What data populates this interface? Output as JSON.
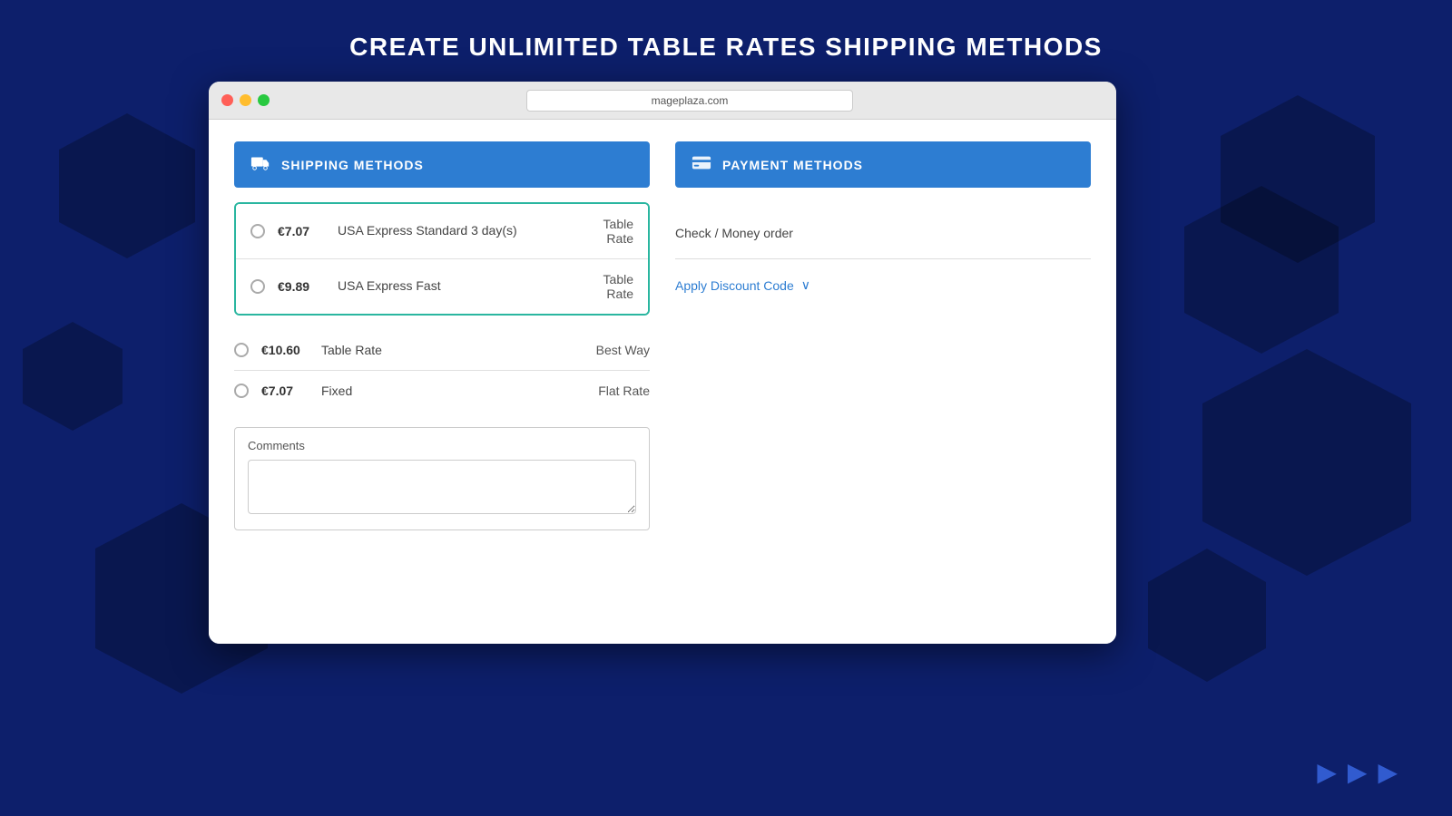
{
  "page": {
    "title": "CREATE UNLIMITED TABLE RATES SHIPPING METHODS",
    "address_bar": "mageplaza.com"
  },
  "shipping_section": {
    "header_label": "SHIPPING METHODS",
    "header_icon": "🚚",
    "highlighted_rows": [
      {
        "price": "€7.07",
        "name": "USA Express Standard 3 day(s)",
        "method_line1": "Table",
        "method_line2": "Rate"
      },
      {
        "price": "€9.89",
        "name": "USA Express Fast",
        "method_line1": "Table",
        "method_line2": "Rate"
      }
    ],
    "plain_rows": [
      {
        "price": "€10.60",
        "name": "Table Rate",
        "method": "Best Way"
      },
      {
        "price": "€7.07",
        "name": "Fixed",
        "method": "Flat Rate"
      }
    ],
    "comments_label": "Comments",
    "comments_placeholder": ""
  },
  "payment_section": {
    "header_label": "PAYMENT METHODS",
    "header_icon": "💳",
    "payment_option": "Check / Money order",
    "discount_label": "Apply Discount Code",
    "chevron": "∨"
  },
  "decorative": {
    "arrows": [
      "▶",
      "▶",
      "▶"
    ]
  }
}
